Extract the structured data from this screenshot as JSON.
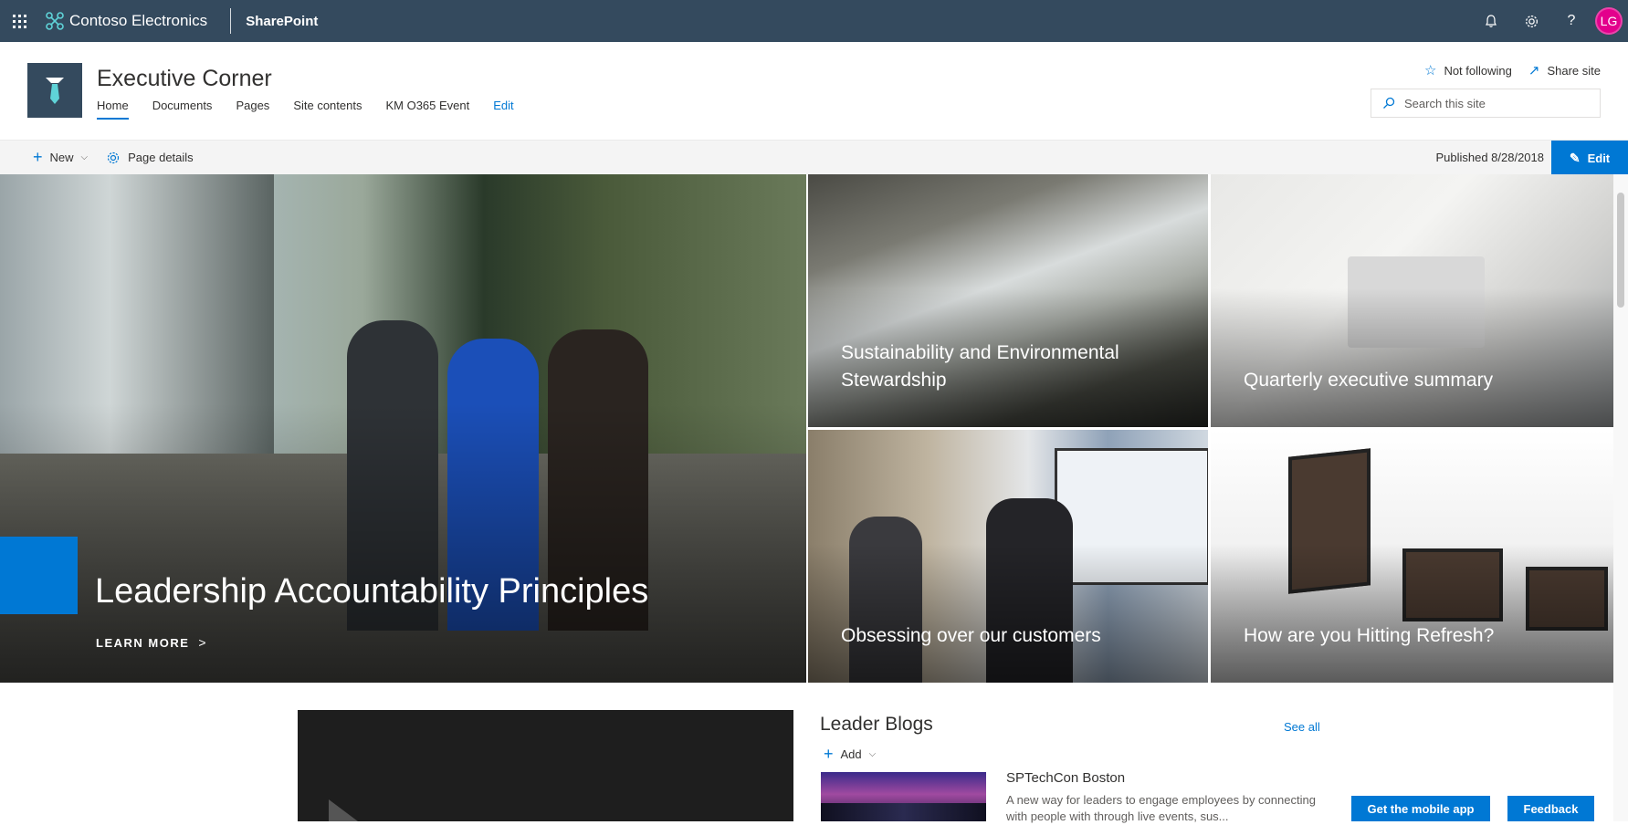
{
  "suite": {
    "org_name": "Contoso Electronics",
    "product_name": "SharePoint",
    "avatar_initials": "LG",
    "icons": [
      "app-launcher-icon",
      "bell-icon",
      "gear-icon",
      "help-icon"
    ],
    "colors": {
      "suitebar": "#344a5e",
      "avatar": "#e3008c"
    }
  },
  "site": {
    "title": "Executive Corner",
    "nav": [
      {
        "label": "Home",
        "active": true
      },
      {
        "label": "Documents"
      },
      {
        "label": "Pages"
      },
      {
        "label": "Site contents"
      },
      {
        "label": "KM O365 Event"
      },
      {
        "label": "Edit"
      }
    ],
    "follow_label": "Not following",
    "share_label": "Share site",
    "search_placeholder": "Search this site"
  },
  "command_bar": {
    "new_label": "New",
    "page_details_label": "Page details",
    "published": "Published 8/28/2018",
    "edit_label": "Edit"
  },
  "hero": {
    "main": {
      "title": "Leadership Accountability Principles",
      "link_label": "LEARN MORE"
    },
    "tiles": [
      {
        "caption": "Sustainability and Environmental Stewardship"
      },
      {
        "caption": "Quarterly executive summary"
      },
      {
        "caption": "Obsessing over our customers"
      },
      {
        "caption": "How are you Hitting Refresh?"
      }
    ]
  },
  "blogs": {
    "title": "Leader Blogs",
    "see_all": "See all",
    "add_label": "Add",
    "items": [
      {
        "title": "SPTechCon Boston",
        "description": "A new way for leaders to engage employees by connecting with people with through live events, sus..."
      }
    ]
  },
  "footer_buttons": {
    "mobile_app": "Get the mobile app",
    "feedback": "Feedback"
  },
  "accent": "#0078d4"
}
